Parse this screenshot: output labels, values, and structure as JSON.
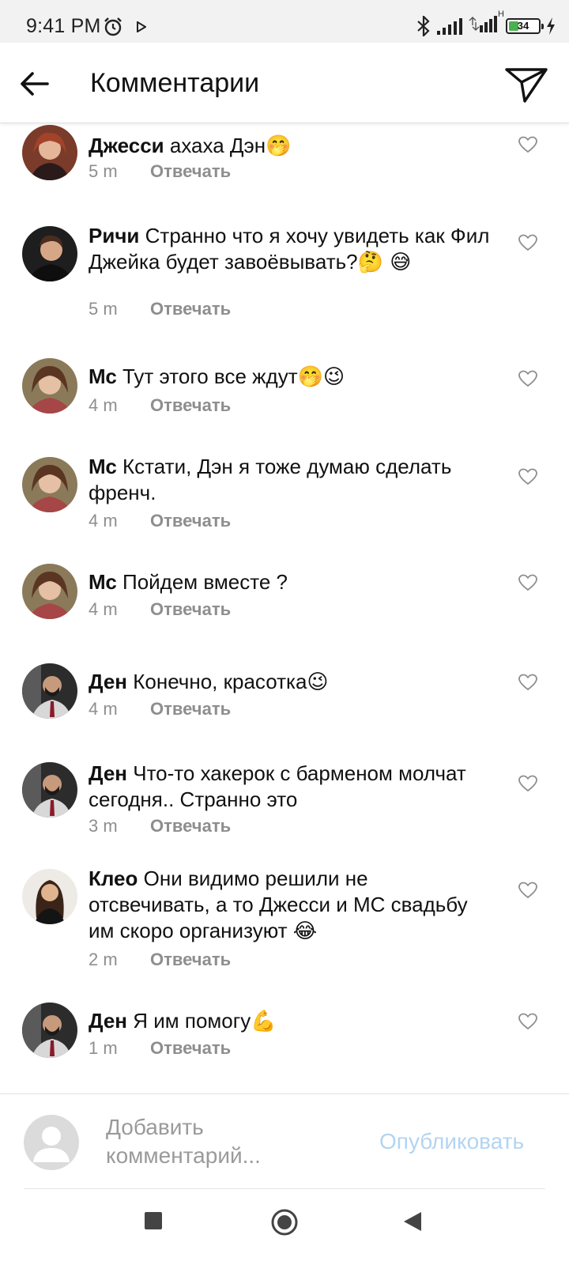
{
  "status_bar": {
    "time": "9:41 PM",
    "battery_level": "34",
    "battery_fraction": 0.34,
    "network_label": "H",
    "icons": [
      "alarm-icon",
      "play-icon",
      "bluetooth-icon",
      "signal-icon",
      "battery-icon",
      "charging-icon"
    ]
  },
  "header": {
    "title": "Комментарии",
    "icons": [
      "back-arrow-icon",
      "send-icon"
    ]
  },
  "comments": [
    {
      "user": "Джесси",
      "text": " ахаха Дэн",
      "emoji": "🤭",
      "time": "5 m",
      "reply": "Отвечать"
    },
    {
      "user": "Ричи",
      "text": " Странно что я хочу увидеть как Фил Джейка будет завоёвывать?",
      "emoji": "🤔 😅",
      "time": "5 m",
      "reply": "Отвечать"
    },
    {
      "user": "Мс",
      "text": " Тут этого все ждут",
      "emoji": "🤭😉",
      "time": "4 m",
      "reply": "Отвечать"
    },
    {
      "user": "Мс",
      "text": " Кстати, Дэн я тоже думаю сделать френч.",
      "emoji": "",
      "time": "4 m",
      "reply": "Отвечать"
    },
    {
      "user": "Мс",
      "text": " Пойдем вместе ?",
      "emoji": "",
      "time": "4 m",
      "reply": "Отвечать"
    },
    {
      "user": "Ден",
      "text": " Конечно, красотка",
      "emoji": "😉",
      "time": "4 m",
      "reply": "Отвечать"
    },
    {
      "user": "Ден",
      "text": " Что-то хакерок с барменом молчат сегодня.. Странно это",
      "emoji": "",
      "time": "3 m",
      "reply": "Отвечать"
    },
    {
      "user": "Клео",
      "text": " Они видимо решили не отсвечивать, а то Джесси и МС свадьбу им скоро организуют ",
      "emoji": "😂",
      "time": "2 m",
      "reply": "Отвечать"
    },
    {
      "user": "Ден",
      "text": " Я им помогу",
      "emoji": "💪",
      "time": "1 m",
      "reply": "Отвечать"
    }
  ],
  "add_comment": {
    "placeholder": "Добавить комментарий...",
    "publish_label": "Опубликовать"
  },
  "nav_bar": {
    "icons": [
      "recents-square-icon",
      "home-circle-icon",
      "back-triangle-icon"
    ]
  },
  "colors": {
    "publish_disabled": "#b3d4f2",
    "meta_gray": "#8e8e8e",
    "battery_green": "#4caf50"
  }
}
